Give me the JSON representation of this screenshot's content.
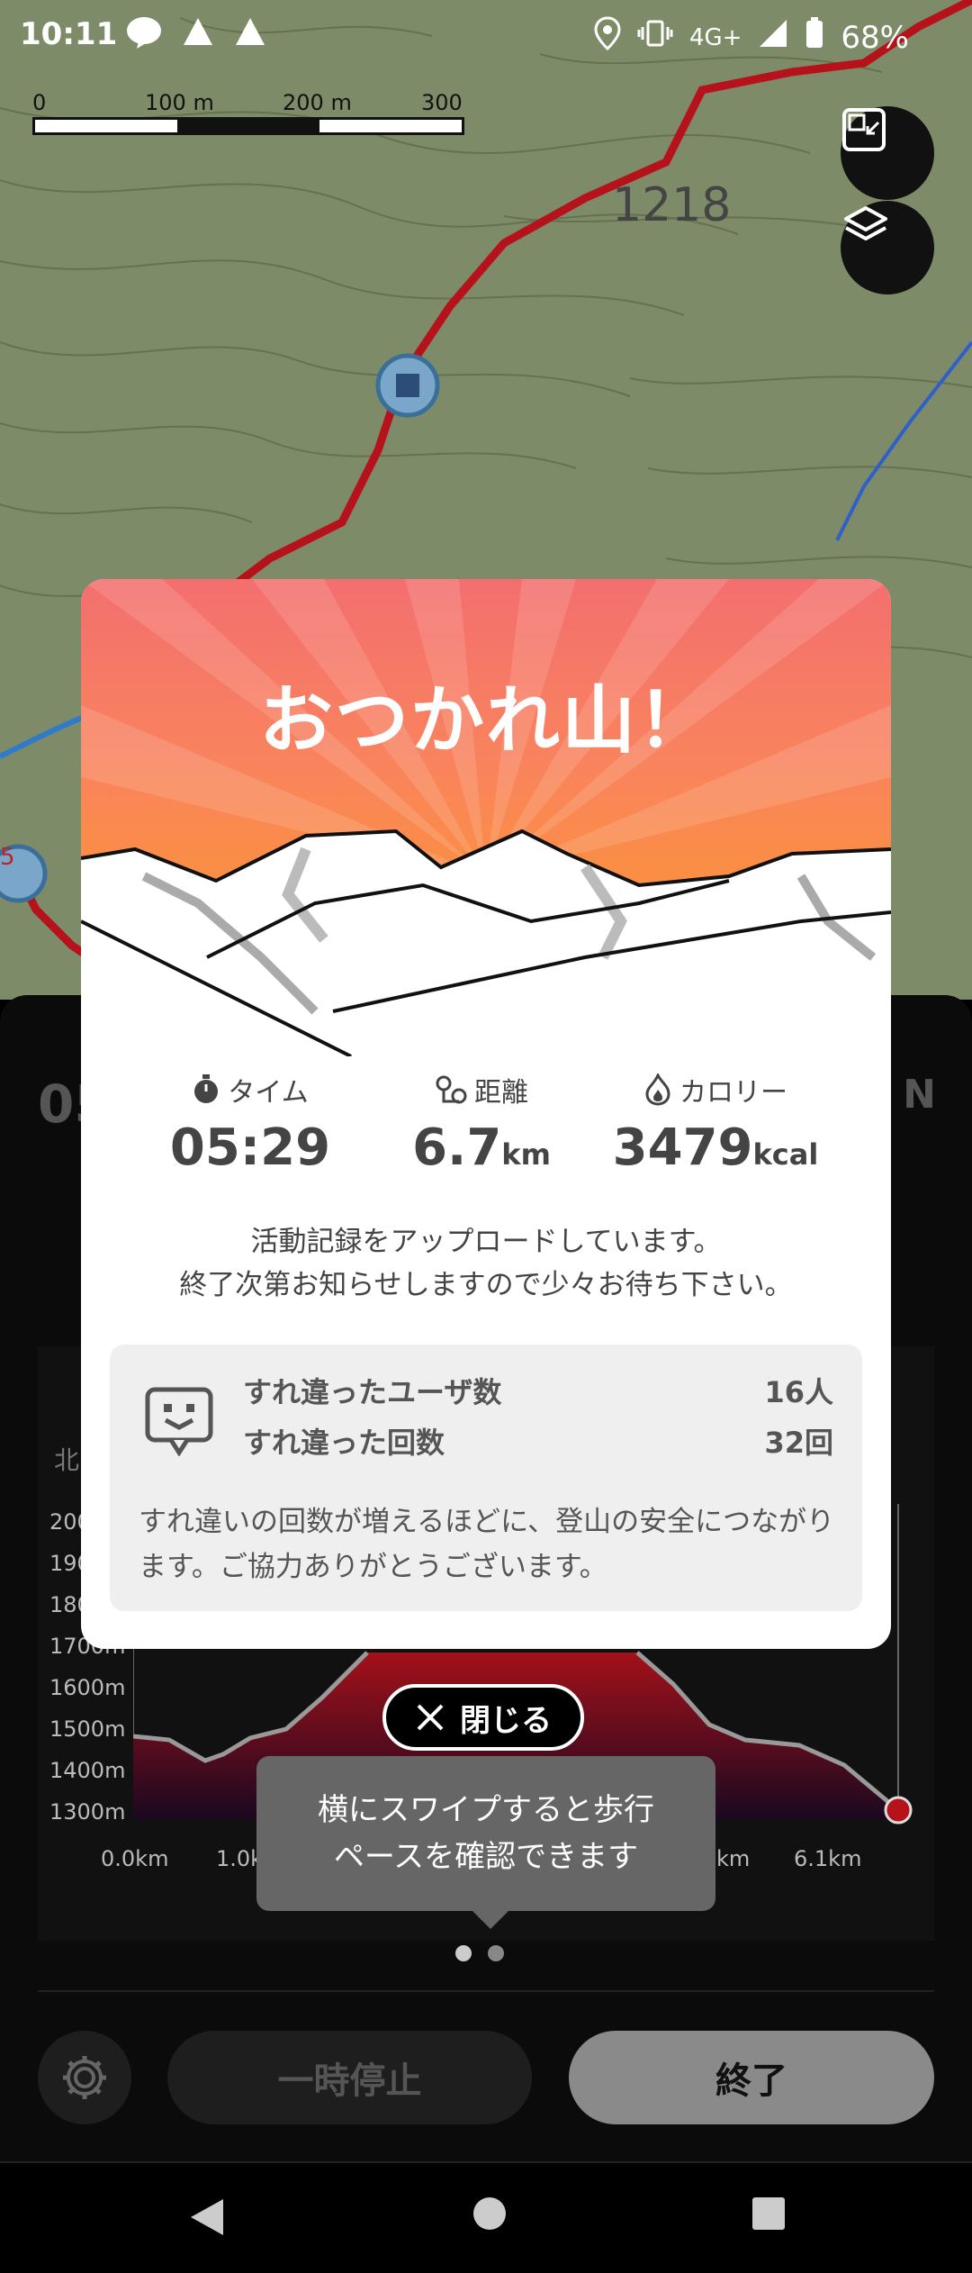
{
  "status_bar": {
    "time": "10:11",
    "network": "4G+",
    "battery": "68%"
  },
  "map": {
    "scale": [
      "0",
      "100 m",
      "200 m",
      "300 m"
    ],
    "contour_label": "1218",
    "marker_label": "5"
  },
  "panel": {
    "time_partial": "05",
    "compass_partial": "N",
    "elevation_heading": "北",
    "y_labels": [
      "200",
      "190",
      "180",
      "1700m",
      "1600m",
      "1500m",
      "1400m",
      "1300m"
    ],
    "x_labels": [
      "0.0km",
      "1.0k",
      "km",
      "6.1km"
    ],
    "pause_label": "一時停止",
    "end_label": "終了",
    "tooltip": [
      "横にスワイプすると歩行",
      "ペースを確認できます"
    ],
    "close_label": "閉じる"
  },
  "modal": {
    "title": "おつかれ山！",
    "stats": {
      "time": {
        "label": "タイム",
        "value": "05:29",
        "unit": ""
      },
      "distance": {
        "label": "距離",
        "value": "6.7",
        "unit": "km"
      },
      "calorie": {
        "label": "カロリー",
        "value": "3479",
        "unit": "kcal"
      }
    },
    "message_line1": "活動記録をアップロードしています。",
    "message_line2": "終了次第お知らせしますので少々お待ち下さい。",
    "encounter": {
      "users_label": "すれ違ったユーザ数",
      "users_value": "16人",
      "count_label": "すれ違った回数",
      "count_value": "32回",
      "note": "すれ違いの回数が増えるほどに、登山の安全につながります。ご協力ありがとうございます。"
    }
  },
  "colors": {
    "hero_top": "#f36f6f",
    "hero_bottom": "#fb9040",
    "route": "#b5121b",
    "end_button": "#8a8a8a"
  }
}
